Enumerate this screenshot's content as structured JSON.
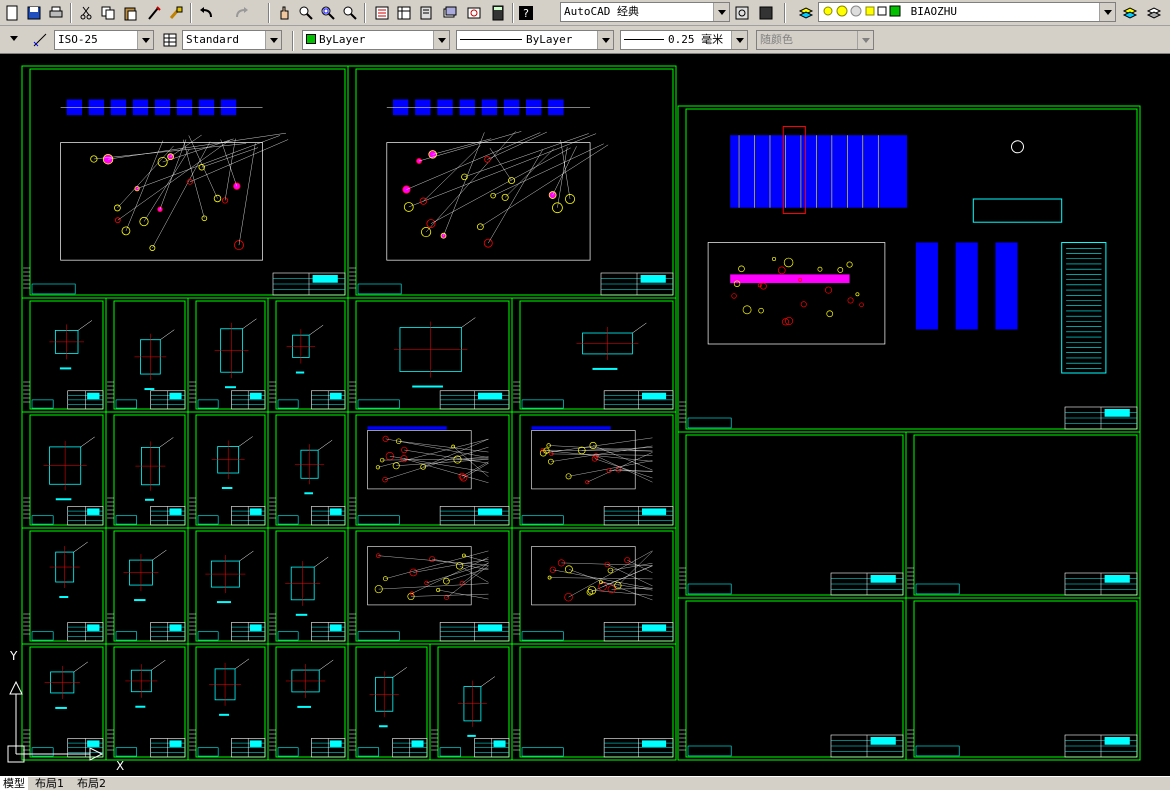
{
  "toolbar_standard": {
    "workspace_value": "AutoCAD 经典",
    "layer_value": "BIAOZHU",
    "icons": [
      "qnew-icon",
      "save-icon",
      "plot-icon",
      "cut-icon",
      "copy-icon",
      "paste-icon",
      "matchprop-icon",
      "brush-icon",
      "undo-icon",
      "redo-icon",
      "pan-icon",
      "zoom-realtime-icon",
      "zoom-window-icon",
      "zoom-previous-icon",
      "properties-icon",
      "designcenter-icon",
      "toolpalettes-icon",
      "sheetset-icon",
      "markup-icon",
      "calculator-icon",
      "help-icon",
      "workspace-settings-icon",
      "layer-manager-icon",
      "layer-state-icon",
      "make-current-icon",
      "layer-previous-icon"
    ]
  },
  "toolbar_styles": {
    "dim_style_value": "ISO-25",
    "table_style_value": "Standard",
    "color_value": "ByLayer",
    "color_hex": "#00c000",
    "linetype_value": "ByLayer",
    "lineweight_value": "0.25 毫米",
    "plotstyle_value": "随颜色"
  },
  "ucs": {
    "y_label": "Y",
    "x_label": "X"
  },
  "tabs": [
    {
      "label": "模型",
      "active": true
    },
    {
      "label": "布局1",
      "active": false
    },
    {
      "label": "布局2",
      "active": false
    }
  ],
  "colors": {
    "background": "#000000",
    "frame": "#00ff00",
    "line": "#00ffff",
    "fill": "#0000ff",
    "highlight": "#ff00ff",
    "dims": "#ffffff",
    "holes": "#ff0000",
    "circles": "#ffff00"
  }
}
